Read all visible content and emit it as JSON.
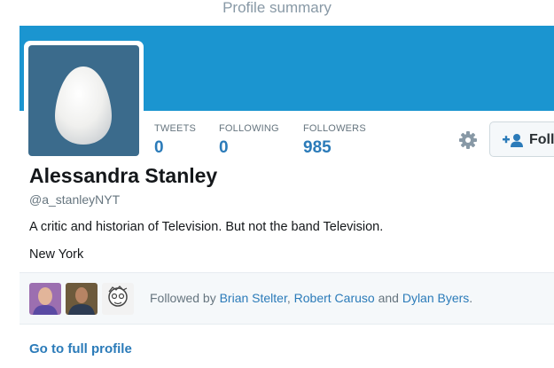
{
  "modal": {
    "title": "Profile summary"
  },
  "profile": {
    "name": "Alessandra Stanley",
    "handle": "@a_stanleyNYT",
    "bio": "A critic and historian of Television. But not the band Television.",
    "location": "New York"
  },
  "stats": [
    {
      "label": "TWEETS",
      "value": "0"
    },
    {
      "label": "FOLLOWING",
      "value": "0"
    },
    {
      "label": "FOLLOWERS",
      "value": "985"
    }
  ],
  "actions": {
    "follow_label": "Foll"
  },
  "followed_by": {
    "prefix": "Followed by",
    "users": [
      "Brian Stelter",
      "Robert Caruso",
      "Dylan Byers"
    ],
    "sep1": ",",
    "sep2": "and",
    "suffix": "."
  },
  "footer": {
    "full_profile_link": "Go to full profile"
  },
  "colors": {
    "banner": "#1b95d0",
    "avatar_bg": "#3b6b8c",
    "link": "#2b7bb9"
  }
}
